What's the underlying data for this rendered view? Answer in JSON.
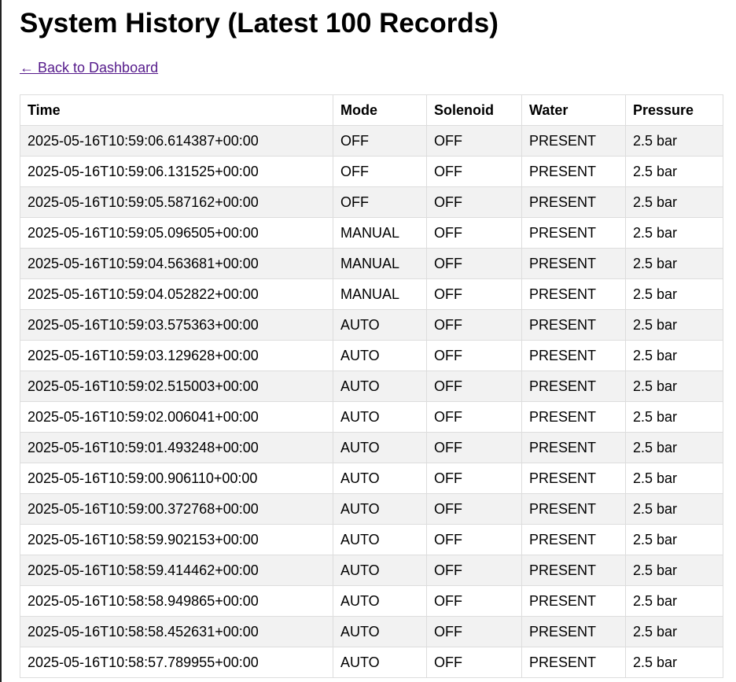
{
  "page": {
    "title": "System History (Latest 100 Records)",
    "back_link": "← Back to Dashboard"
  },
  "table": {
    "headers": [
      "Time",
      "Mode",
      "Solenoid",
      "Water",
      "Pressure"
    ],
    "rows": [
      [
        "2025-05-16T10:59:06.614387+00:00",
        "OFF",
        "OFF",
        "PRESENT",
        "2.5 bar"
      ],
      [
        "2025-05-16T10:59:06.131525+00:00",
        "OFF",
        "OFF",
        "PRESENT",
        "2.5 bar"
      ],
      [
        "2025-05-16T10:59:05.587162+00:00",
        "OFF",
        "OFF",
        "PRESENT",
        "2.5 bar"
      ],
      [
        "2025-05-16T10:59:05.096505+00:00",
        "MANUAL",
        "OFF",
        "PRESENT",
        "2.5 bar"
      ],
      [
        "2025-05-16T10:59:04.563681+00:00",
        "MANUAL",
        "OFF",
        "PRESENT",
        "2.5 bar"
      ],
      [
        "2025-05-16T10:59:04.052822+00:00",
        "MANUAL",
        "OFF",
        "PRESENT",
        "2.5 bar"
      ],
      [
        "2025-05-16T10:59:03.575363+00:00",
        "AUTO",
        "OFF",
        "PRESENT",
        "2.5 bar"
      ],
      [
        "2025-05-16T10:59:03.129628+00:00",
        "AUTO",
        "OFF",
        "PRESENT",
        "2.5 bar"
      ],
      [
        "2025-05-16T10:59:02.515003+00:00",
        "AUTO",
        "OFF",
        "PRESENT",
        "2.5 bar"
      ],
      [
        "2025-05-16T10:59:02.006041+00:00",
        "AUTO",
        "OFF",
        "PRESENT",
        "2.5 bar"
      ],
      [
        "2025-05-16T10:59:01.493248+00:00",
        "AUTO",
        "OFF",
        "PRESENT",
        "2.5 bar"
      ],
      [
        "2025-05-16T10:59:00.906110+00:00",
        "AUTO",
        "OFF",
        "PRESENT",
        "2.5 bar"
      ],
      [
        "2025-05-16T10:59:00.372768+00:00",
        "AUTO",
        "OFF",
        "PRESENT",
        "2.5 bar"
      ],
      [
        "2025-05-16T10:58:59.902153+00:00",
        "AUTO",
        "OFF",
        "PRESENT",
        "2.5 bar"
      ],
      [
        "2025-05-16T10:58:59.414462+00:00",
        "AUTO",
        "OFF",
        "PRESENT",
        "2.5 bar"
      ],
      [
        "2025-05-16T10:58:58.949865+00:00",
        "AUTO",
        "OFF",
        "PRESENT",
        "2.5 bar"
      ],
      [
        "2025-05-16T10:58:58.452631+00:00",
        "AUTO",
        "OFF",
        "PRESENT",
        "2.5 bar"
      ],
      [
        "2025-05-16T10:58:57.789955+00:00",
        "AUTO",
        "OFF",
        "PRESENT",
        "2.5 bar"
      ]
    ]
  }
}
